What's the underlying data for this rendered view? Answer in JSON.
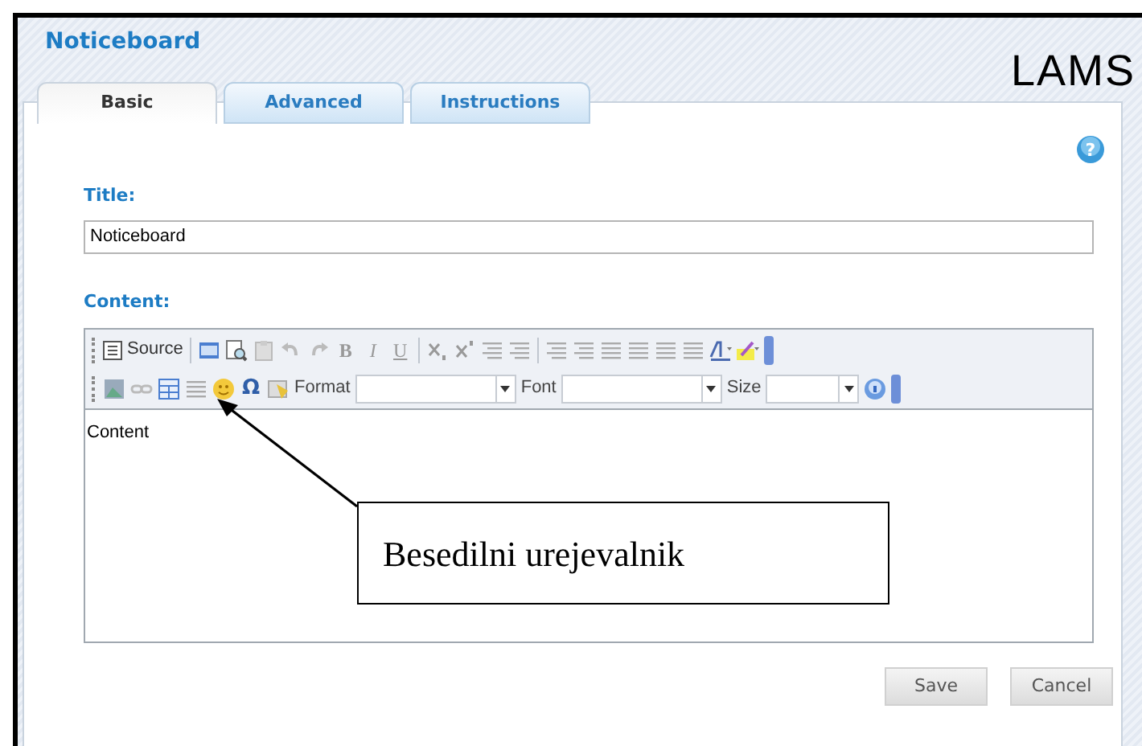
{
  "header": {
    "title": "Noticeboard",
    "logo": "LAMS"
  },
  "help": {
    "symbol": "?"
  },
  "tabs": [
    {
      "label": "Basic",
      "selected": true
    },
    {
      "label": "Advanced",
      "selected": false
    },
    {
      "label": "Instructions",
      "selected": false
    }
  ],
  "title_field": {
    "label": "Title:",
    "value": "Noticeboard"
  },
  "content_field": {
    "label": "Content:",
    "value": "Content",
    "toolbar": {
      "source": "Source",
      "bold": "B",
      "italic": "I",
      "underline": "U",
      "omega": "Ω",
      "format": "Format",
      "font": "Font",
      "size": "Size"
    }
  },
  "callout": {
    "text": "Besedilni urejevalnik"
  },
  "buttons": [
    {
      "label": "Save"
    },
    {
      "label": "Cancel"
    }
  ]
}
